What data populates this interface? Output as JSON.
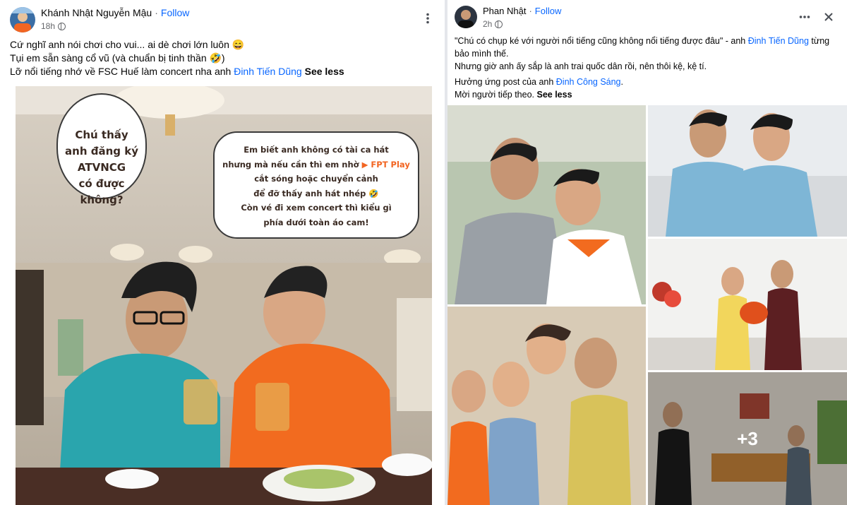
{
  "left_post": {
    "author": "Khánh Nhật Nguyễn Mậu",
    "follow_label": "Follow",
    "time": "18h",
    "caption": {
      "line1": "Cứ nghĩ anh nói chơi cho vui... ai dè chơi lớn luôn 😄",
      "line2": "Tụi em sẵn sàng cổ vũ (và chuẩn bị tinh thần 🤣)",
      "line3_text": "Lỡ nổi tiếng nhớ về FSC Huế làm concert nha anh ",
      "line3_link": "Đinh Tiến Dũng",
      "see_less": "See less"
    },
    "photo": {
      "bubble1": [
        "Chú thấy",
        "anh đăng ký",
        "ATVNCG",
        "có được không?"
      ],
      "bubble2_line1": "Em biết anh không có tài ca hát",
      "bubble2_line2": "nhưng mà nếu cần thì em nhờ",
      "bubble2_brand": "FPT Play",
      "bubble2_line3": "cắt sóng hoặc chuyển cảnh",
      "bubble2_line4": "để đỡ thấy anh hát nhép 🤣",
      "bubble2_line5": "Còn vé đi xem concert thì kiểu gì",
      "bubble2_line6": "phía dưới toàn áo cam!"
    }
  },
  "right_post": {
    "author": "Phan Nhật",
    "follow_label": "Follow",
    "time": "2h",
    "caption": {
      "line1_text": "\"Chú có chụp ké với người nổi tiếng cũng không nổi tiếng được đâu\" - anh ",
      "line1_link": "Đinh Tiến Dũng",
      "line1_tail": " từng",
      "line2": "bảo mình thế.",
      "line3": "Nhưng giờ anh ấy sắp là anh trai quốc dân rồi, nên thôi kệ, kệ tí.",
      "line4_text": "Hưởng ứng post của anh ",
      "line4_link": "Đinh Công Sáng",
      "line4_tail": ".",
      "line5": "Mời người tiếp theo.",
      "see_less": "See less"
    },
    "more_photos": "+3"
  },
  "icons": [
    "more-icon",
    "close-icon",
    "globe-icon"
  ]
}
